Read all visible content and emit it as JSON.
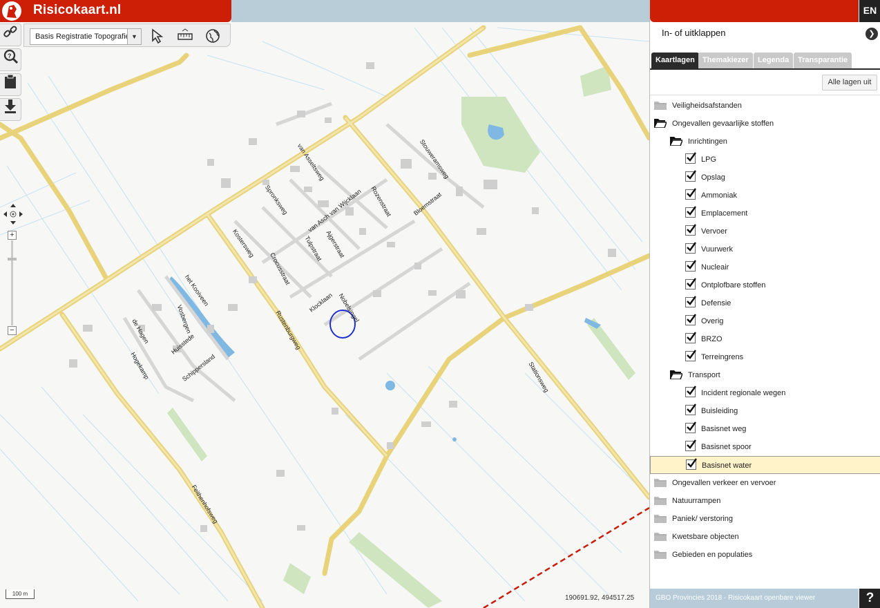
{
  "app": {
    "title": "Risicokaart.nl",
    "lang_button": "EN"
  },
  "map": {
    "base_layer": "Basis Registratie Topografie",
    "coordinates": "190691.92, 494517.25",
    "scale_label": "100 m",
    "streets": [
      "van Asseltsweg",
      "Spronksweg",
      "van Asch van Wijcklaan",
      "Rozenstraat",
      "Stouweramsweg",
      "Bloemstraat",
      "Kostersweg",
      "Tulpstraat",
      "Ajgerstraat",
      "Crocusstraat",
      "het Kooiveen",
      "Vosbergen",
      "Huisstede",
      "de Hagen",
      "Hogekamp",
      "Schippersland",
      "Klocklaan",
      "Nobelsingel",
      "Rustenburgweg",
      "Stationsweg",
      "Feithenhofsweg"
    ]
  },
  "panel": {
    "collapse_label": "In- of uitklappen",
    "tabs": [
      "Kaartlagen",
      "Themakiezer",
      "Legenda",
      "Transparantie"
    ],
    "all_off": "Alle lagen uit",
    "groups": {
      "veiligheid": "Veiligheidsafstanden",
      "ongevallen": "Ongevallen gevaarlijke stoffen",
      "inrichtingen": "Inrichtingen",
      "inrichtingen_items": [
        "LPG",
        "Opslag",
        "Ammoniak",
        "Emplacement",
        "Vervoer",
        "Vuurwerk",
        "Nucleair",
        "Ontplofbare stoffen",
        "Defensie",
        "Overig",
        "BRZO",
        "Terreingrens"
      ],
      "transport": "Transport",
      "transport_items": [
        "Incident regionale wegen",
        "Buisleiding",
        "Basisnet weg",
        "Basisnet spoor",
        "Basisnet water"
      ],
      "others": [
        "Ongevallen verkeer en vervoer",
        "Natuurrampen",
        "Paniek/ verstoring",
        "Kwetsbare objecten",
        "Gebieden en populaties"
      ]
    },
    "footer": "GBO Provincies 2018 - Risicokaart openbare viewer",
    "help": "?"
  }
}
